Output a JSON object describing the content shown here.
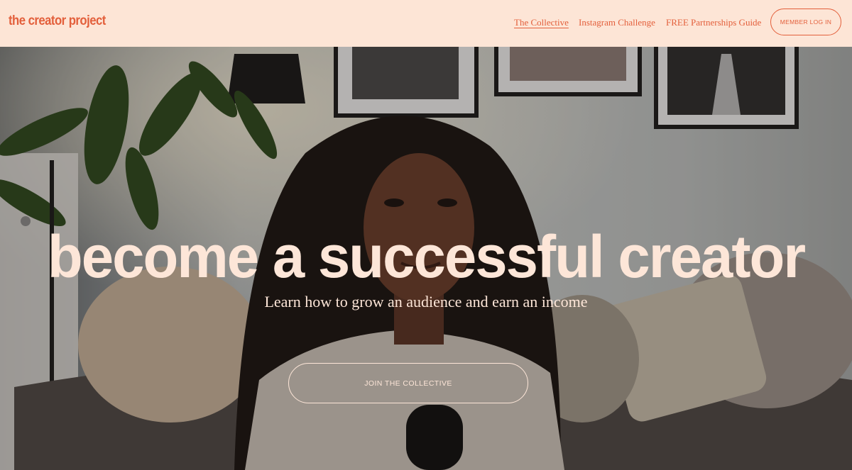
{
  "header": {
    "logo": "the creator project",
    "nav": [
      "The Collective",
      "Instagram Challenge",
      "FREE Partnerships Guide"
    ],
    "login_label": "MEMBER LOG IN"
  },
  "hero": {
    "headline": "become a successful creator",
    "subheadline": "Learn how to grow an audience and earn an income",
    "cta_label": "JOIN THE COLLECTIVE"
  },
  "colors": {
    "brand_orange": "#e35f3b",
    "header_bg": "#fde5d6",
    "hero_text": "#fde6d8"
  }
}
